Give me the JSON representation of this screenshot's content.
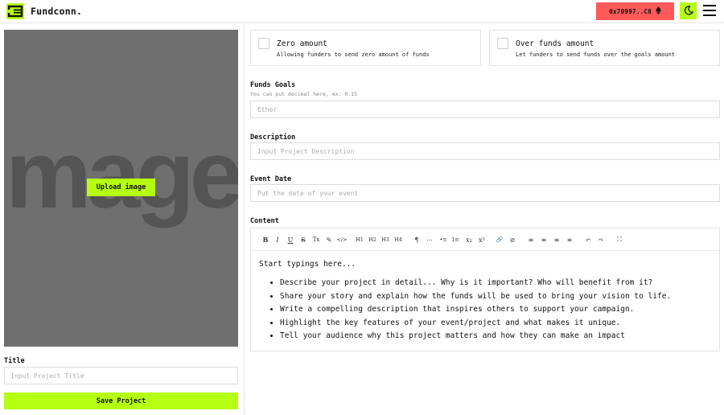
{
  "header": {
    "brand": "Fundconn.",
    "wallet_label": "0x70997..C8",
    "wallet_icon": "ethereum-icon",
    "theme_icon": "moon-icon",
    "menu_icon": "hamburger-menu-icon",
    "accent_color": "#b5ff12",
    "wallet_color": "#ff5a5a"
  },
  "image_panel": {
    "background_text": "mage",
    "upload_label": "Upload image"
  },
  "title_field": {
    "label": "Title",
    "placeholder": "Input Project Title"
  },
  "save_label": "Save Project",
  "options": [
    {
      "title": "Zero amount",
      "description": "Allowing funders to send zero amount of funds"
    },
    {
      "title": "Over funds amount",
      "description": "Let funders to send funds over the goals amount"
    }
  ],
  "funds_goals": {
    "label": "Funds Goals",
    "hint": "You can put decimal here, ex: 0.15",
    "placeholder": "Ether"
  },
  "description": {
    "label": "Description",
    "placeholder": "Input Project Description"
  },
  "event_date": {
    "label": "Event Date",
    "placeholder": "Put the date of your event"
  },
  "content": {
    "label": "Content",
    "toolbar": [
      "B",
      "I",
      "U",
      "S",
      "Tx",
      "✎",
      "</>",
      "H1",
      "H2",
      "H3",
      "H4",
      "¶",
      "⋯",
      "•≡",
      "1≡",
      "x₂",
      "x²",
      "🔗",
      "⊘",
      "≡",
      "≡",
      "≡",
      "≡",
      "↶",
      "↷",
      "⛶"
    ],
    "intro": "Start typings here...",
    "bullets": [
      "Describe your project in detail... Why is it important? Who will benefit from it?",
      "Share your story and explain how the funds will be used to bring your vision to life.",
      "Write a compelling description that inspires others to support your campaign.",
      "Highlight the key features of your event/project and what makes it unique.",
      "Tell your audience why this project matters and how they can make an impact"
    ]
  }
}
